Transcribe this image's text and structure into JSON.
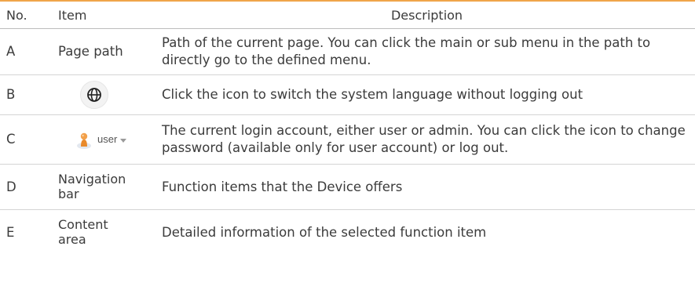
{
  "header": {
    "no": "No.",
    "item": "Item",
    "description": "Description"
  },
  "rows": [
    {
      "no": "A",
      "item": "Page path",
      "description": "Path of the current page. You can click the main or sub menu in the path to directly go to the defined menu."
    },
    {
      "no": "B",
      "item_icon": "globe-icon",
      "description": "Click the icon to switch the system language without logging out"
    },
    {
      "no": "C",
      "item_icon": "user-avatar-icon",
      "item_user_label": "user",
      "description": "The current login account, either user or admin. You can click the icon to change password (available only for user account) or log out."
    },
    {
      "no": "D",
      "item_line1": "Navigation",
      "item_line2": "bar",
      "description": "Function items that the Device offers"
    },
    {
      "no": "E",
      "item_line1": "Content",
      "item_line2": "area",
      "description": "Detailed information of the selected function item"
    }
  ],
  "colors": {
    "header_rule": "#f0a54a",
    "text": "#3b3b3b",
    "row_divider": "#d4d4d4"
  }
}
